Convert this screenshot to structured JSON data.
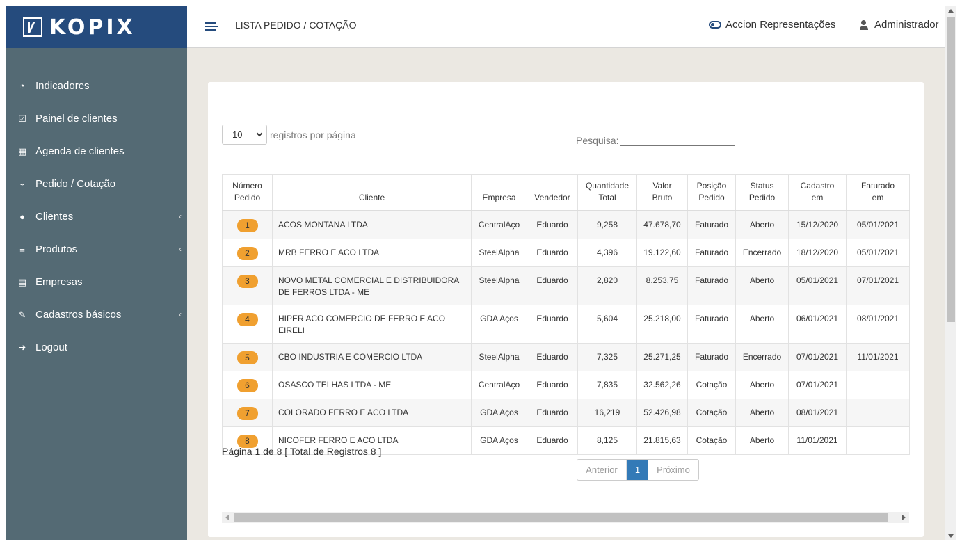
{
  "brand": {
    "name": "KOPIX"
  },
  "sidebar": {
    "items": [
      {
        "label": "Indicadores",
        "icon": "dashboard-icon",
        "has_submenu": false
      },
      {
        "label": "Painel de clientes",
        "icon": "check-square-icon",
        "has_submenu": false
      },
      {
        "label": "Agenda de clientes",
        "icon": "calendar-icon",
        "has_submenu": false
      },
      {
        "label": "Pedido / Cotação",
        "icon": "cart-icon",
        "has_submenu": false
      },
      {
        "label": "Clientes",
        "icon": "users-icon",
        "has_submenu": true
      },
      {
        "label": "Produtos",
        "icon": "list-icon",
        "has_submenu": true
      },
      {
        "label": "Empresas",
        "icon": "factory-icon",
        "has_submenu": false
      },
      {
        "label": "Cadastros básicos",
        "icon": "edit-icon",
        "has_submenu": true
      },
      {
        "label": "Logout",
        "icon": "sign-out-icon",
        "has_submenu": false
      }
    ]
  },
  "header": {
    "title": "LISTA PEDIDO / COTAÇÃO",
    "company": "Accion Representações",
    "user": "Administrador"
  },
  "controls": {
    "page_length": "10",
    "page_length_label": "registros por página",
    "search_label": "Pesquisa:",
    "search_value": ""
  },
  "table": {
    "headers": [
      [
        "Número",
        "Pedido"
      ],
      [
        "Cliente"
      ],
      [
        "Empresa"
      ],
      [
        "Vendedor"
      ],
      [
        "Quantidade",
        "Total"
      ],
      [
        "Valor",
        "Bruto"
      ],
      [
        "Posição",
        "Pedido"
      ],
      [
        "Status",
        "Pedido"
      ],
      [
        "Cadastro",
        "em"
      ],
      [
        "Faturado",
        "em"
      ]
    ],
    "rows": [
      [
        "1",
        "ACOS MONTANA LTDA",
        "CentralAço",
        "Eduardo",
        "9,258",
        "47.678,70",
        "Faturado",
        "Aberto",
        "15/12/2020",
        "05/01/2021"
      ],
      [
        "2",
        "MRB FERRO E ACO LTDA",
        "SteelAlpha",
        "Eduardo",
        "4,396",
        "19.122,60",
        "Faturado",
        "Encerrado",
        "18/12/2020",
        "05/01/2021"
      ],
      [
        "3",
        "NOVO METAL COMERCIAL E DISTRIBUIDORA DE FERROS LTDA - ME",
        "SteelAlpha",
        "Eduardo",
        "2,820",
        "8.253,75",
        "Faturado",
        "Aberto",
        "05/01/2021",
        "07/01/2021"
      ],
      [
        "4",
        "HIPER ACO COMERCIO DE FERRO E ACO EIRELI",
        "GDA Aços",
        "Eduardo",
        "5,604",
        "25.218,00",
        "Faturado",
        "Aberto",
        "06/01/2021",
        "08/01/2021"
      ],
      [
        "5",
        "CBO INDUSTRIA E COMERCIO LTDA",
        "SteelAlpha",
        "Eduardo",
        "7,325",
        "25.271,25",
        "Faturado",
        "Encerrado",
        "07/01/2021",
        "11/01/2021"
      ],
      [
        "6",
        "OSASCO TELHAS LTDA - ME",
        "CentralAço",
        "Eduardo",
        "7,835",
        "32.562,26",
        "Cotação",
        "Aberto",
        "07/01/2021",
        ""
      ],
      [
        "7",
        "COLORADO FERRO E ACO LTDA",
        "GDA Aços",
        "Eduardo",
        "16,219",
        "52.426,98",
        "Cotação",
        "Aberto",
        "08/01/2021",
        ""
      ],
      [
        "8",
        "NICOFER FERRO E ACO LTDA",
        "GDA Aços",
        "Eduardo",
        "8,125",
        "21.815,63",
        "Cotação",
        "Aberto",
        "11/01/2021",
        ""
      ]
    ]
  },
  "footer": {
    "info": "Página 1 de 8 [ Total de Registros 8 ]",
    "prev_label": "Anterior",
    "current_page": "1",
    "next_label": "Próximo"
  },
  "colors": {
    "sidebar": "#546a74",
    "brand": "#254b7d",
    "badge": "#f0a030",
    "pager_active": "#337ab7",
    "background": "#ebe8e2"
  }
}
